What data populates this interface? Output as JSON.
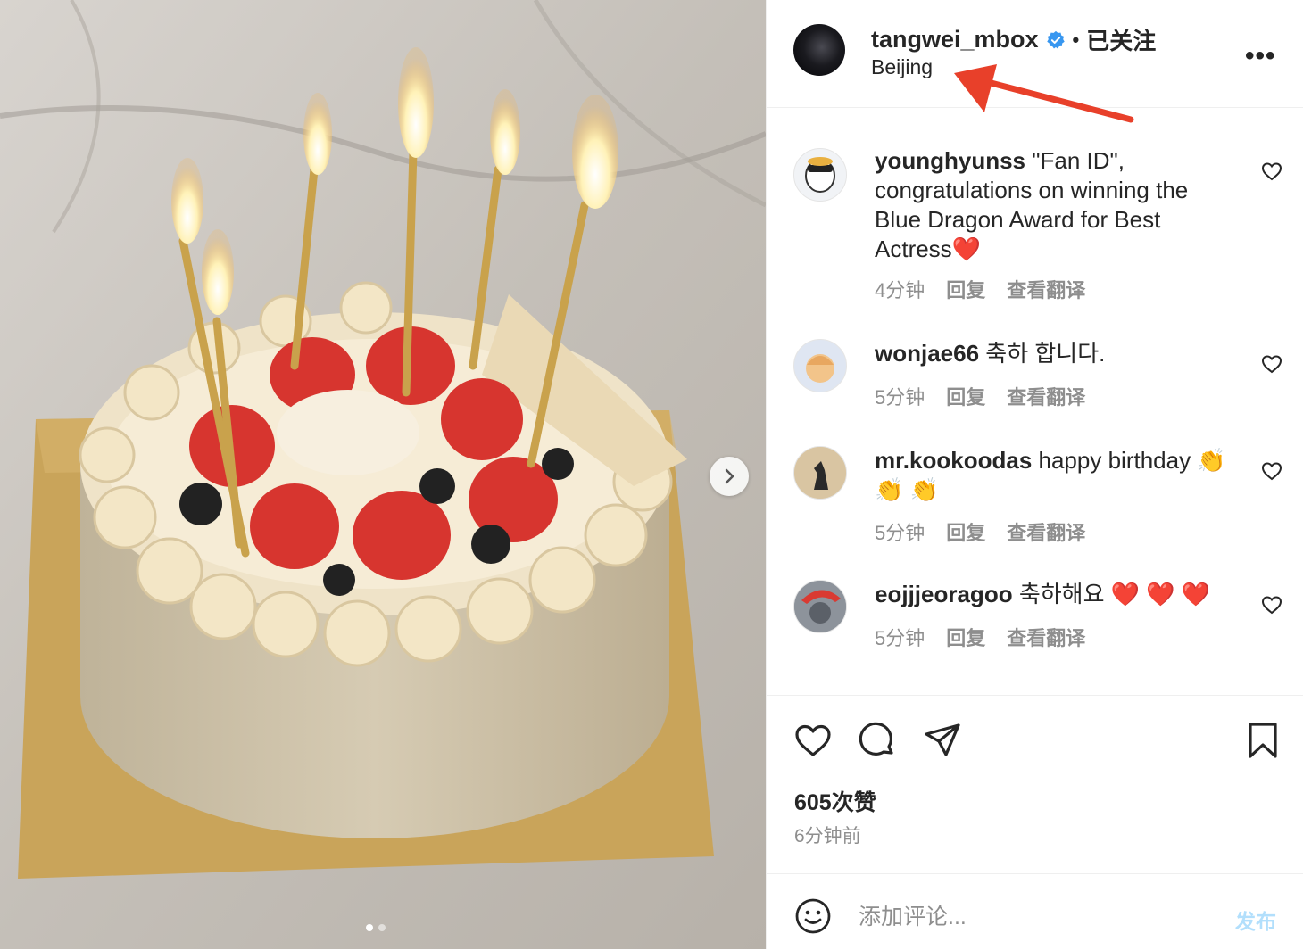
{
  "post": {
    "username": "tangwei_mbox",
    "separator": "•",
    "follow_status": "已关注",
    "location": "Beijing",
    "more_icon": "more-options-icon",
    "photo_count": 2,
    "active_photo": 1
  },
  "comments": [
    {
      "username": "younghyunss",
      "text": "\"Fan ID\", congratulations on winning the Blue Dragon Award for Best Actress❤️",
      "time": "4分钟",
      "reply": "回复",
      "translate": "查看翻译"
    },
    {
      "username": "wonjae66",
      "text": "축하 합니다.",
      "time": "5分钟",
      "reply": "回复",
      "translate": "查看翻译"
    },
    {
      "username": "mr.kookoodas",
      "text": "happy birthday 👏 👏 👏",
      "time": "5分钟",
      "reply": "回复",
      "translate": "查看翻译"
    },
    {
      "username": "eojjjeoragoo",
      "text": "축하해요 ❤️ ❤️ ❤️",
      "time": "5分钟",
      "reply": "回复",
      "translate": "查看翻译"
    }
  ],
  "stats": {
    "likes": "605次赞",
    "posted": "6分钟前"
  },
  "composer": {
    "placeholder": "添加评论...",
    "post_label": "发布"
  },
  "colors": {
    "accent": "#0095f6",
    "verified": "#3897f0",
    "arrow": "#e8402a"
  }
}
